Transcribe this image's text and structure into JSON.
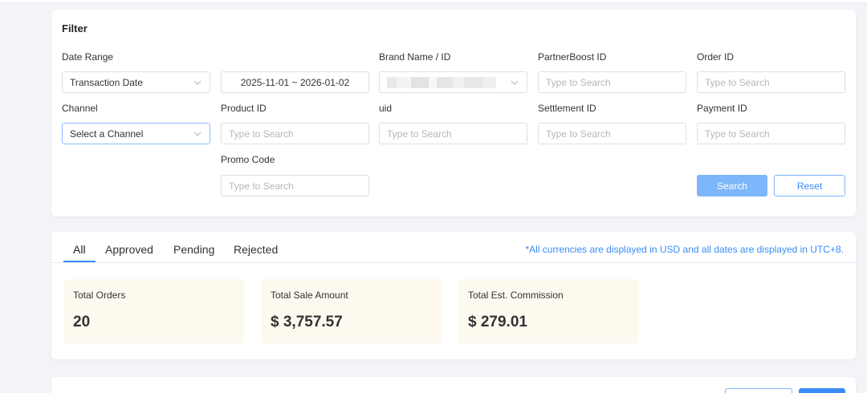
{
  "filter": {
    "title": "Filter",
    "date_range": {
      "label": "Date Range",
      "type_value": "Transaction Date",
      "range_value": "2025-11-01 ~ 2026-01-02"
    },
    "brand": {
      "label": "Brand Name / ID"
    },
    "partnerboost_id": {
      "label": "PartnerBoost ID",
      "placeholder": "Type to Search"
    },
    "order_id": {
      "label": "Order ID",
      "placeholder": "Type to Search"
    },
    "channel": {
      "label": "Channel",
      "placeholder": "Select a Channel"
    },
    "product_id": {
      "label": "Product ID",
      "placeholder": "Type to Search"
    },
    "uid": {
      "label": "uid",
      "placeholder": "Type to Search"
    },
    "settlement_id": {
      "label": "Settlement ID",
      "placeholder": "Type to Search"
    },
    "payment_id": {
      "label": "Payment ID",
      "placeholder": "Type to Search"
    },
    "promo_code": {
      "label": "Promo Code",
      "placeholder": "Type to Search"
    },
    "search_label": "Search",
    "reset_label": "Reset"
  },
  "tabs": [
    {
      "label": "All",
      "active": true
    },
    {
      "label": "Approved",
      "active": false
    },
    {
      "label": "Pending",
      "active": false
    },
    {
      "label": "Rejected",
      "active": false
    }
  ],
  "currency_note": "*All currencies are displayed in USD and all dates are displayed in UTC+8.",
  "stats": [
    {
      "label": "Total Orders",
      "value": "20"
    },
    {
      "label": "Total Sale Amount",
      "value": "$ 3,757.57"
    },
    {
      "label": "Total Est. Commission",
      "value": "$ 279.01"
    }
  ],
  "colors": {
    "accent": "#3a8cf5",
    "button_fill": "#7db6fb",
    "stat_bg": "#fef9ef",
    "page_bg": "#f3f4f7"
  },
  "icons": {
    "dropdown": "chevron-down-icon"
  }
}
